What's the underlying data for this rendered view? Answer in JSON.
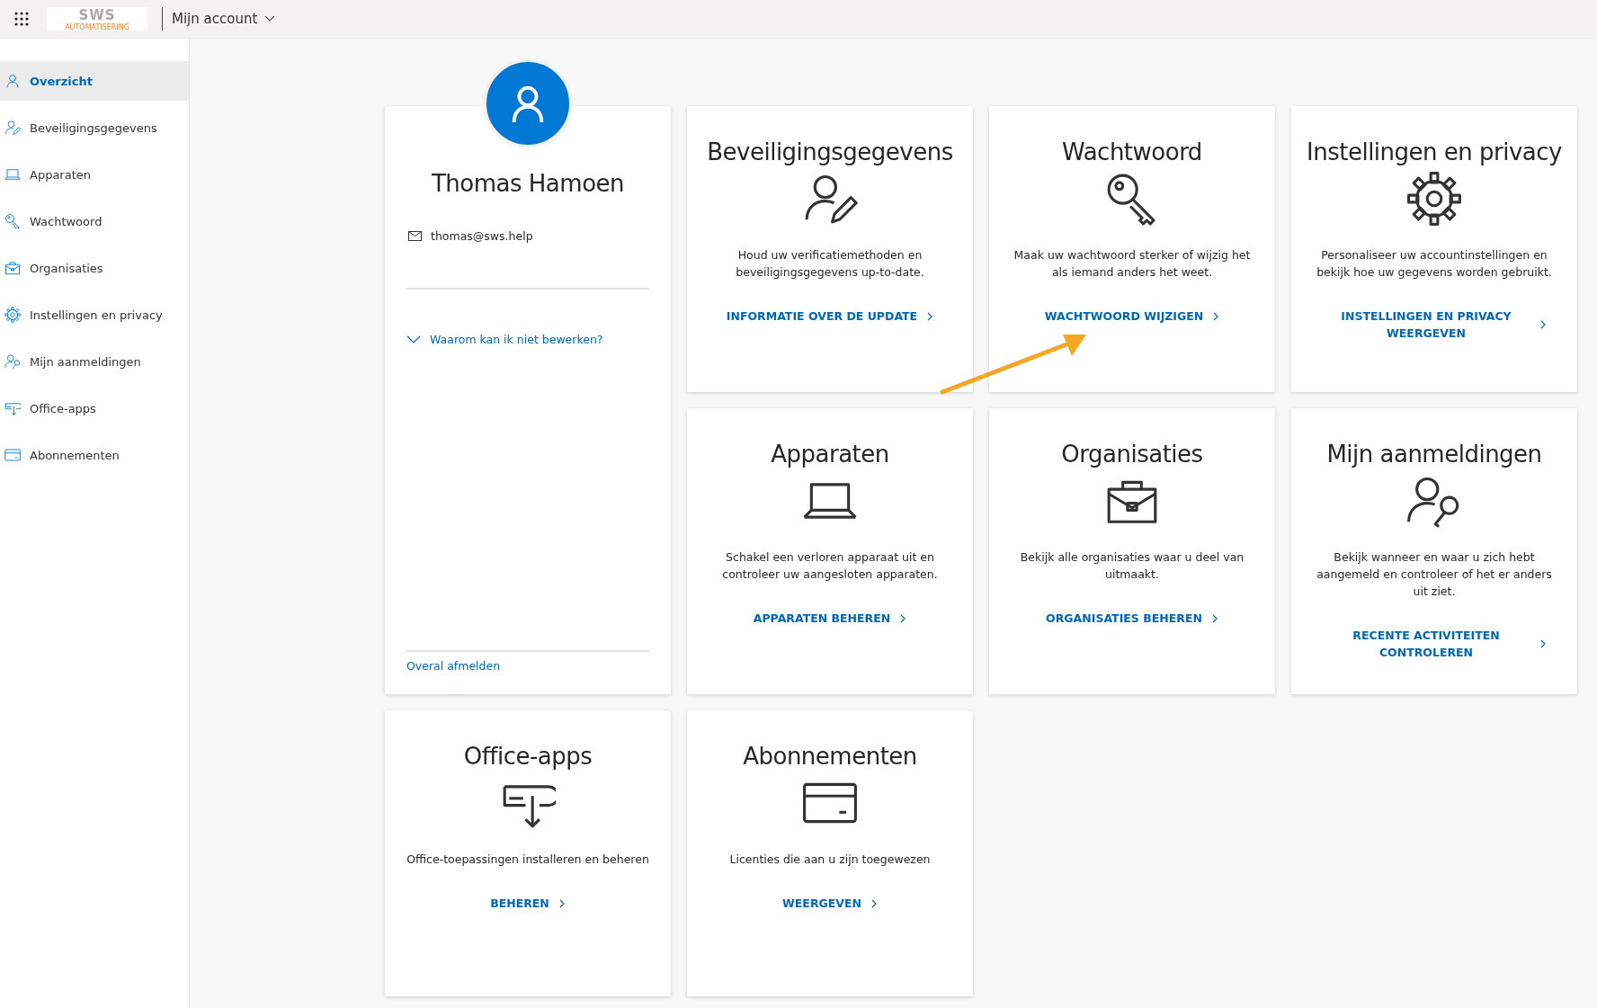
{
  "top_bar": {
    "logo": {
      "text": "SWS",
      "tagline": "AUTOMATISERING"
    },
    "title": "Mijn account"
  },
  "sidebar": {
    "items": [
      {
        "label": "Overzicht",
        "kind": "person",
        "selected": true
      },
      {
        "label": "Beveiligingsgegevens",
        "kind": "person-edit",
        "selected": false
      },
      {
        "label": "Apparaten",
        "kind": "laptop",
        "selected": false
      },
      {
        "label": "Wachtwoord",
        "kind": "key",
        "selected": false
      },
      {
        "label": "Organisaties",
        "kind": "briefcase",
        "selected": false
      },
      {
        "label": "Instellingen en privacy",
        "kind": "gear",
        "selected": false
      },
      {
        "label": "Mijn aanmeldingen",
        "kind": "person-key",
        "selected": false
      },
      {
        "label": "Office-apps",
        "kind": "apps",
        "selected": false
      },
      {
        "label": "Abonnementen",
        "kind": "card",
        "selected": false
      }
    ]
  },
  "profile": {
    "name": "Thomas Hamoen",
    "email": "thomas@sws.help",
    "help_link": "Waarom kan ik niet bewerken?",
    "sign_out_link": "Overal afmelden"
  },
  "cards": [
    {
      "title": "Beveiligingsgegevens",
      "kind": "person-edit",
      "description": "Houd uw verificatiemethoden en beveiligingsgegevens up-to-date.",
      "link": "INFORMATIE OVER DE UPDATE"
    },
    {
      "title": "Wachtwoord",
      "kind": "key",
      "description": "Maak uw wachtwoord sterker of wijzig het als iemand anders het weet.",
      "link": "WACHTWOORD WIJZIGEN"
    },
    {
      "title": "Instellingen en privacy",
      "kind": "gear",
      "description": "Personaliseer uw accountinstellingen en bekijk hoe uw gegevens worden gebruikt.",
      "link": "INSTELLINGEN EN PRIVACY WEERGEVEN"
    },
    {
      "title": "Apparaten",
      "kind": "laptop",
      "description": "Schakel een verloren apparaat uit en controleer uw aangesloten apparaten.",
      "link": "APPARATEN BEHEREN"
    },
    {
      "title": "Organisaties",
      "kind": "briefcase",
      "description": "Bekijk alle organisaties waar u deel van uitmaakt.",
      "link": "ORGANISATIES BEHEREN"
    },
    {
      "title": "Mijn aanmeldingen",
      "kind": "person-key",
      "description": "Bekijk wanneer en waar u zich hebt aangemeld en controleer of het er anders uit ziet.",
      "link": "RECENTE ACTIVITEITEN CONTROLEREN"
    },
    {
      "title": "Office-apps",
      "kind": "apps",
      "description": "Office-toepassingen installeren en beheren",
      "link": "BEHEREN"
    },
    {
      "title": "Abonnementen",
      "kind": "card",
      "description": "Licenties die aan u zijn toegewezen",
      "link": "WEERGEVEN"
    }
  ]
}
